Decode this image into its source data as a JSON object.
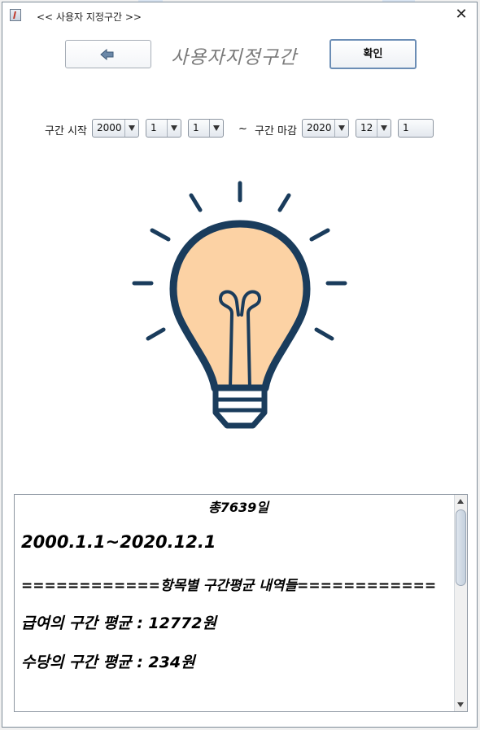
{
  "window": {
    "title": "<< 사용자 지정구간 >>",
    "close_icon": "close-icon"
  },
  "toolbar": {
    "back_icon": "arrow-left-icon",
    "page_title": "사용자지정구간",
    "confirm_label": "확인"
  },
  "range": {
    "start_label": "구간 시작",
    "start_year": "2000",
    "start_month": "1",
    "start_day": "1",
    "separator": "~",
    "end_label": "구간 마감",
    "end_year": "2020",
    "end_month": "12",
    "end_day": "1"
  },
  "illustration": {
    "icon": "lightbulb-icon",
    "fill_color": "#fcd2a4",
    "stroke_color": "#1a3c5c"
  },
  "result": {
    "total_days": "총7639일",
    "period": "2000.1.1~2020.12.1",
    "header": "============항목별 구간평균 내역들============",
    "salary_avg": "급여의 구간 평균 : 12772원",
    "allowance_avg": "수당의 구간 평균 : 234원"
  }
}
